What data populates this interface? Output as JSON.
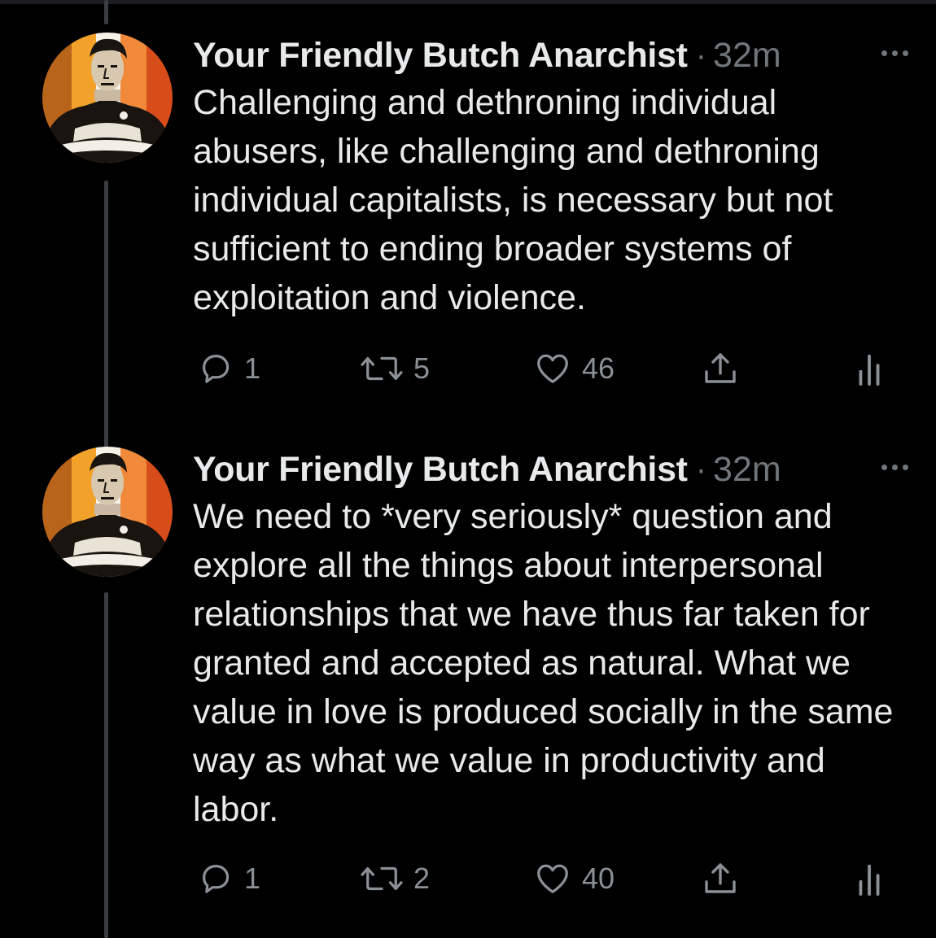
{
  "theme": {
    "background": "#000000",
    "text": "#e7e9ea",
    "muted": "#71767b",
    "thread_line": "#3a3d41"
  },
  "tweets": [
    {
      "display_name": "Your Friendly Butch Anarchist",
      "separator": "·",
      "timestamp": "32m",
      "text": "Challenging and dethroning individual abusers, like challenging and dethroning individual capitalists, is necessary but not sufficient to ending broader systems of exploitation and violence.",
      "reply_count": "1",
      "retweet_count": "5",
      "like_count": "46",
      "icons": [
        "reply-icon",
        "retweet-icon",
        "heart-icon",
        "share-icon",
        "analytics-icon",
        "more-icon"
      ]
    },
    {
      "display_name": "Your Friendly Butch Anarchist",
      "separator": "·",
      "timestamp": "32m",
      "text": "We need to *very seriously* question and explore all the things about interpersonal relationships that we have thus far taken for granted and accepted as natural. What we value in love is produced socially in the same way as what we value in productivity and labor.",
      "reply_count": "1",
      "retweet_count": "2",
      "like_count": "40",
      "icons": [
        "reply-icon",
        "retweet-icon",
        "heart-icon",
        "share-icon",
        "analytics-icon",
        "more-icon"
      ]
    }
  ]
}
